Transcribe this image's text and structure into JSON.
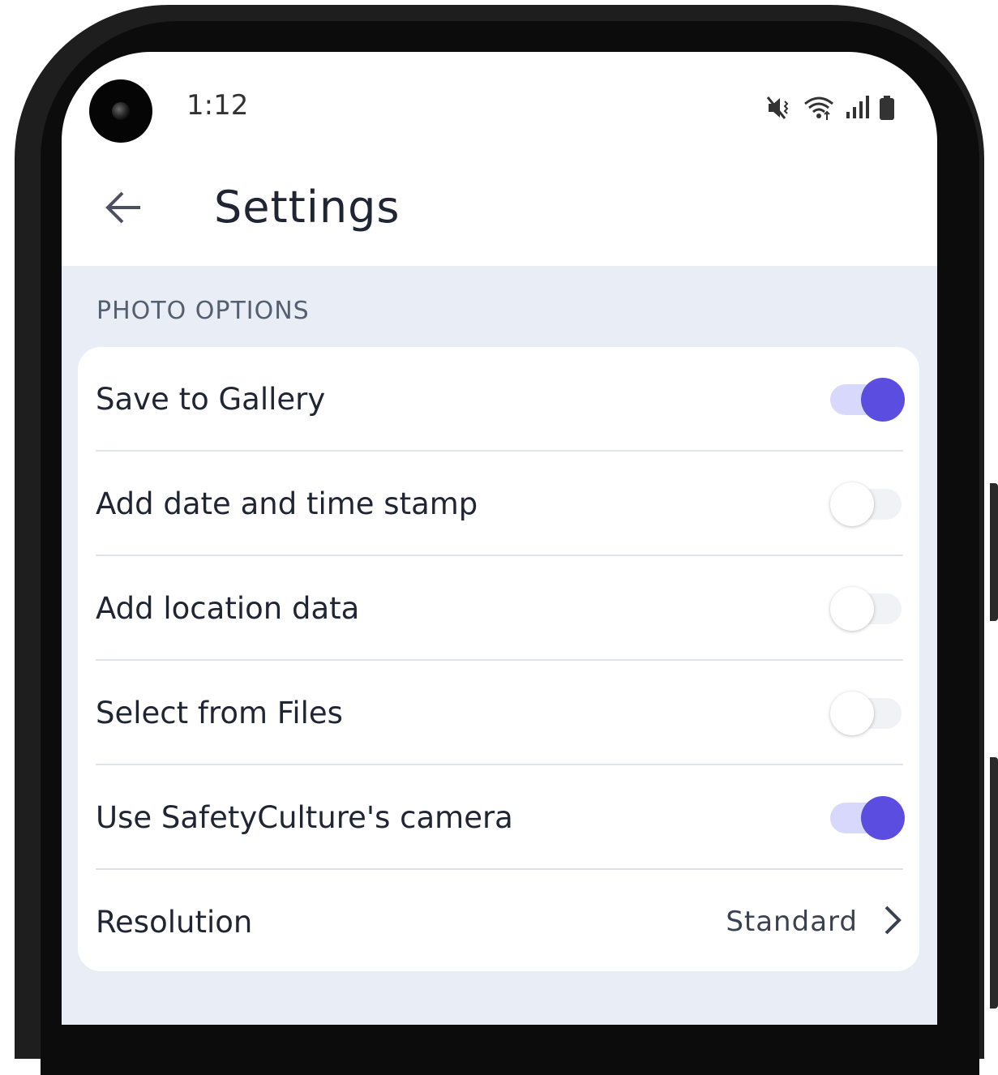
{
  "status_bar": {
    "time": "1:12",
    "icons": [
      "vibrate-mute-icon",
      "wifi-icon",
      "signal-icon",
      "battery-icon"
    ]
  },
  "app_bar": {
    "back_icon": "arrow-left-icon",
    "title": "Settings"
  },
  "photo_options": {
    "section_title": "PHOTO OPTIONS",
    "items": [
      {
        "label": "Save to Gallery",
        "enabled": true
      },
      {
        "label": "Add date and time stamp",
        "enabled": false
      },
      {
        "label": "Add location data",
        "enabled": false
      },
      {
        "label": "Select from Files",
        "enabled": false
      },
      {
        "label": "Use SafetyCulture's camera",
        "enabled": true
      }
    ],
    "resolution": {
      "label": "Resolution",
      "value": "Standard",
      "icon": "chevron-right-icon"
    }
  },
  "colors": {
    "accent": "#5b4de0",
    "accent_track": "#d7d8fb",
    "content_background": "#e9edf5",
    "card_background": "#ffffff",
    "text_primary": "#1f2533",
    "text_secondary": "#545f70"
  }
}
